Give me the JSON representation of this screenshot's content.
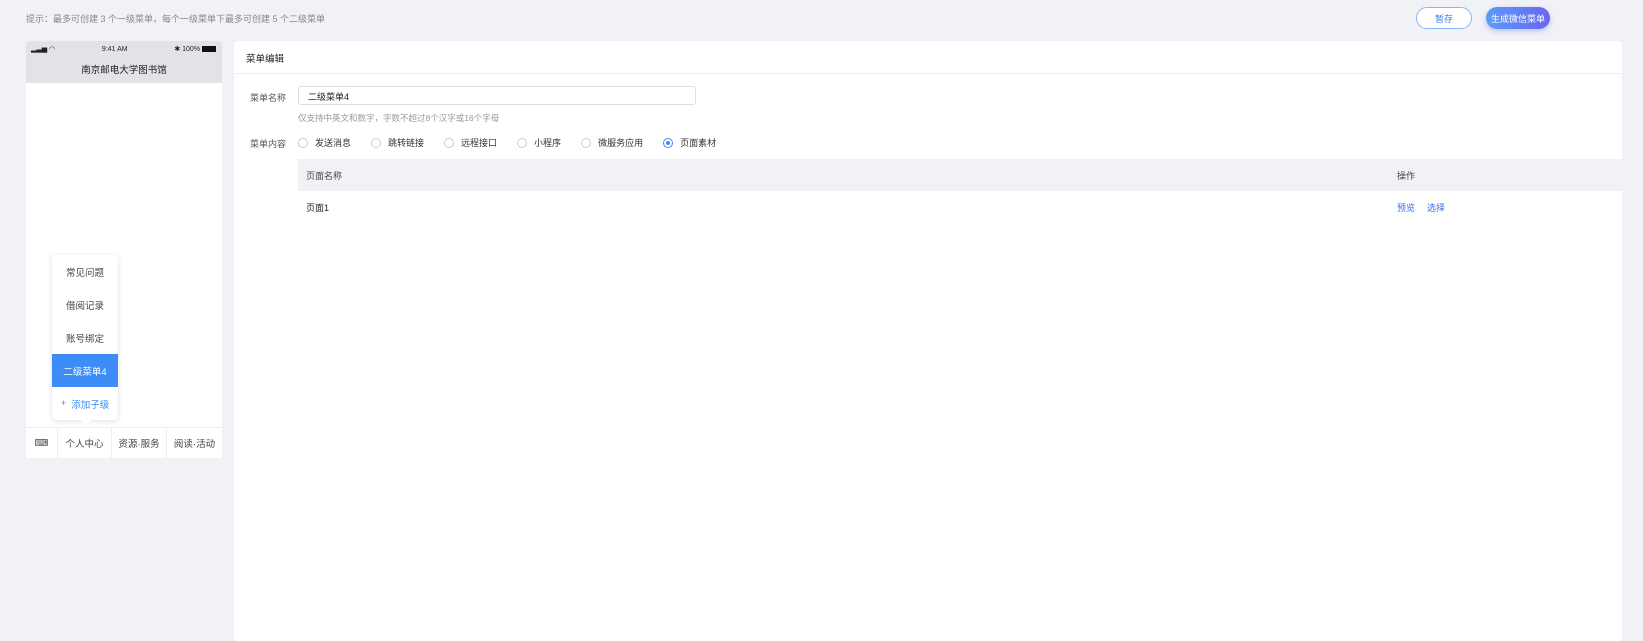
{
  "tip": "提示：最多可创建 3 个一级菜单，每个一级菜单下最多可创建 5 个二级菜单",
  "buttons": {
    "save": "暂存",
    "generate": "生成微信菜单"
  },
  "phone": {
    "time": "9:41 AM",
    "battery": "100%",
    "title": "南京邮电大学图书馆",
    "submenu": [
      "常见问题",
      "借阅记录",
      "账号绑定",
      "二级菜单4"
    ],
    "add_child": "添加子级",
    "tabs": [
      "个人中心",
      "资源·服务",
      "阅读·活动"
    ]
  },
  "editor": {
    "title": "菜单编辑",
    "name_label": "菜单名称",
    "name_value": "二级菜单4",
    "hint": "仅支持中英文和数字，字数不超过8个汉字或16个字母",
    "content_label": "菜单内容",
    "options": [
      "发送消息",
      "跳转链接",
      "远程接口",
      "小程序",
      "微服务应用",
      "页面素材"
    ],
    "selected": 5,
    "table": {
      "headers": [
        "页面名称",
        "操作"
      ],
      "rows": [
        {
          "name": "页面1",
          "actions": [
            "预览",
            "选择"
          ]
        }
      ]
    }
  },
  "colors": {
    "accent": "#3d8cf7"
  }
}
